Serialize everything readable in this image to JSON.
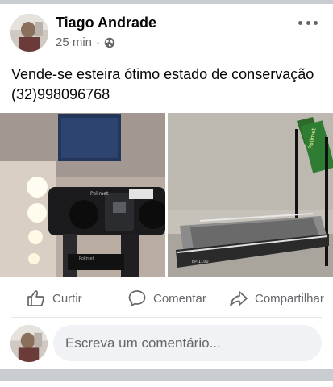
{
  "post": {
    "author": "Tiago Andrade",
    "time": "25 min",
    "separator": "·",
    "privacy_icon": "globe-icon",
    "text": "Vende-se esteira ótimo estado de conservação (32)998096768",
    "photos": [
      {
        "name": "treadmill-console-photo",
        "console_brand": "Polimet",
        "console_label": "Polimet"
      },
      {
        "name": "treadmill-side-photo",
        "side_label": "Polimet",
        "model_label": "EP-1100"
      }
    ]
  },
  "actions": {
    "like_label": "Curtir",
    "comment_label": "Comentar",
    "share_label": "Compartilhar"
  },
  "comment": {
    "placeholder": "Escreva um comentário..."
  },
  "icons": {
    "more": "more-options-icon",
    "like": "thumbs-up-icon",
    "comment": "speech-bubble-icon",
    "share": "share-arrow-icon"
  },
  "colors": {
    "text_primary": "#050505",
    "text_secondary": "#65676b",
    "comment_field": "#f0f2f5",
    "divider": "#c9ccd1"
  }
}
